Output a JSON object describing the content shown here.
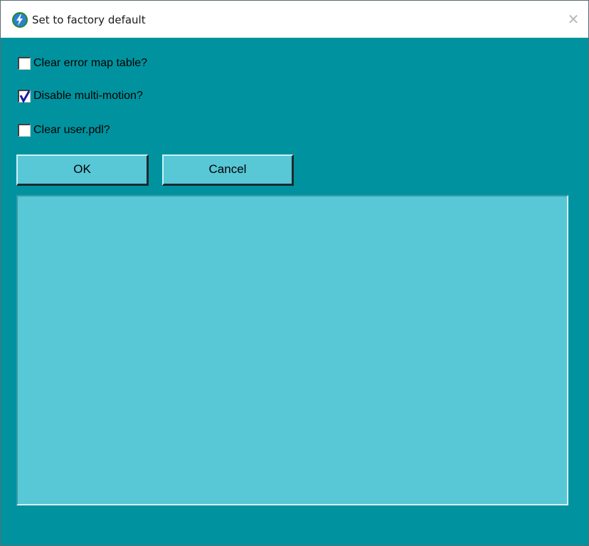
{
  "window": {
    "title": "Set to factory default",
    "close_symbol": "✕",
    "icon": "app-lightning-icon"
  },
  "options": [
    {
      "label": "Clear error map table?",
      "checked": false
    },
    {
      "label": "Disable multi-motion?",
      "checked": true
    },
    {
      "label": "Clear user.pdl?",
      "checked": false
    }
  ],
  "buttons": {
    "ok_label": "OK",
    "cancel_label": "Cancel"
  },
  "output": {
    "text": ""
  },
  "colors": {
    "background": "#00939f",
    "panel": "#58c7d6",
    "check": "#1a1aa0"
  }
}
